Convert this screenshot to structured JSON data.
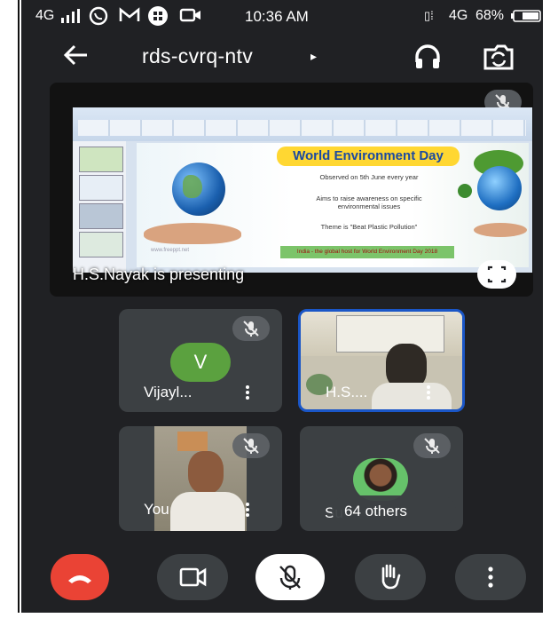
{
  "status_bar": {
    "network": "4G",
    "time": "10:36 AM",
    "network2": "4G",
    "battery": "68%"
  },
  "top_bar": {
    "meeting_code": "rds-cvrq-ntv",
    "caret": "▸",
    "back_icon": "arrow-left-icon",
    "audio_icon": "headphones-icon",
    "switch_camera_icon": "switch-camera-icon"
  },
  "presentation": {
    "slide_title": "World Environment Day",
    "lines": [
      "Observed on 5th June every year",
      "Aims to raise awareness on specific environmental issues",
      "Theme is \"Beat Plastic Pollution\""
    ],
    "footer_bar": "India - the global host for World Environment Day 2018",
    "presenter_label": "H.S.Nayak is presenting",
    "watermark": "www.freeppt.net"
  },
  "participants": [
    {
      "name": "Vijayl...",
      "avatar_letter": "V",
      "muted": true
    },
    {
      "name": "H.S....",
      "muted": false,
      "active_speaker": true
    },
    {
      "name": "You",
      "muted": true
    },
    {
      "name": "64 others",
      "muted": true,
      "partial_label": "Su"
    }
  ],
  "controls": {
    "end_call_icon": "end-call-icon",
    "camera_icon": "camera-icon",
    "mic_icon": "mic-off-icon",
    "raise_hand_icon": "raise-hand-icon",
    "more_icon": "more-vert-icon"
  },
  "colors": {
    "background": "#202124",
    "end_call": "#ea4335",
    "tile": "#3c4043",
    "active_border": "#1a56c7",
    "avatar_green": "#5ba13f"
  }
}
